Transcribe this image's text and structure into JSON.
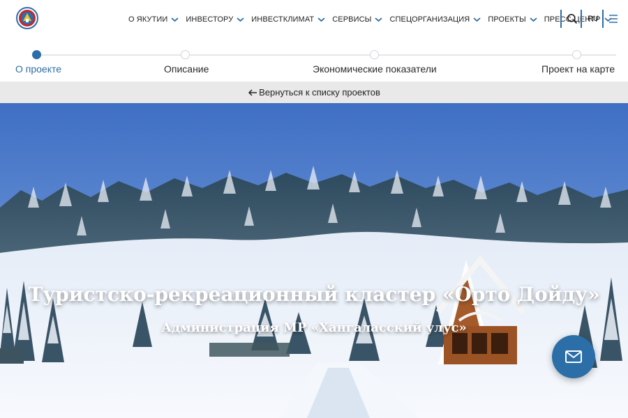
{
  "header": {
    "nav": [
      {
        "label": "О ЯКУТИИ"
      },
      {
        "label": "ИНВЕСТОРУ"
      },
      {
        "label": "ИНВЕСТКЛИМАТ"
      },
      {
        "label": "СЕРВИСЫ"
      },
      {
        "label": "СПЕЦОРГАНИЗАЦИЯ"
      },
      {
        "label": "ПРОЕКТЫ"
      },
      {
        "label": "ПРЕСС-ЦЕНТР"
      }
    ],
    "language": "RU"
  },
  "steps": [
    {
      "label": "О проекте",
      "active": true
    },
    {
      "label": "Описание",
      "active": false
    },
    {
      "label": "Экономические показатели",
      "active": false
    },
    {
      "label": "Проект на карте",
      "active": false
    }
  ],
  "back_link": "Вернуться к списку проектов",
  "hero": {
    "title": "Туристско-рекреационный кластер «Орто Дойду»",
    "subtitle": "Администрация МР «Хангаласский улус»"
  },
  "colors": {
    "accent": "#2b6ea8",
    "backbar": "#e9e9e9"
  },
  "icons": {
    "logo": "yakutia-coat-of-arms",
    "nav_chevron": "chevron-down-icon",
    "search": "search-icon",
    "menu": "menu-icon",
    "back": "arrow-left-icon",
    "mail": "mail-icon"
  }
}
